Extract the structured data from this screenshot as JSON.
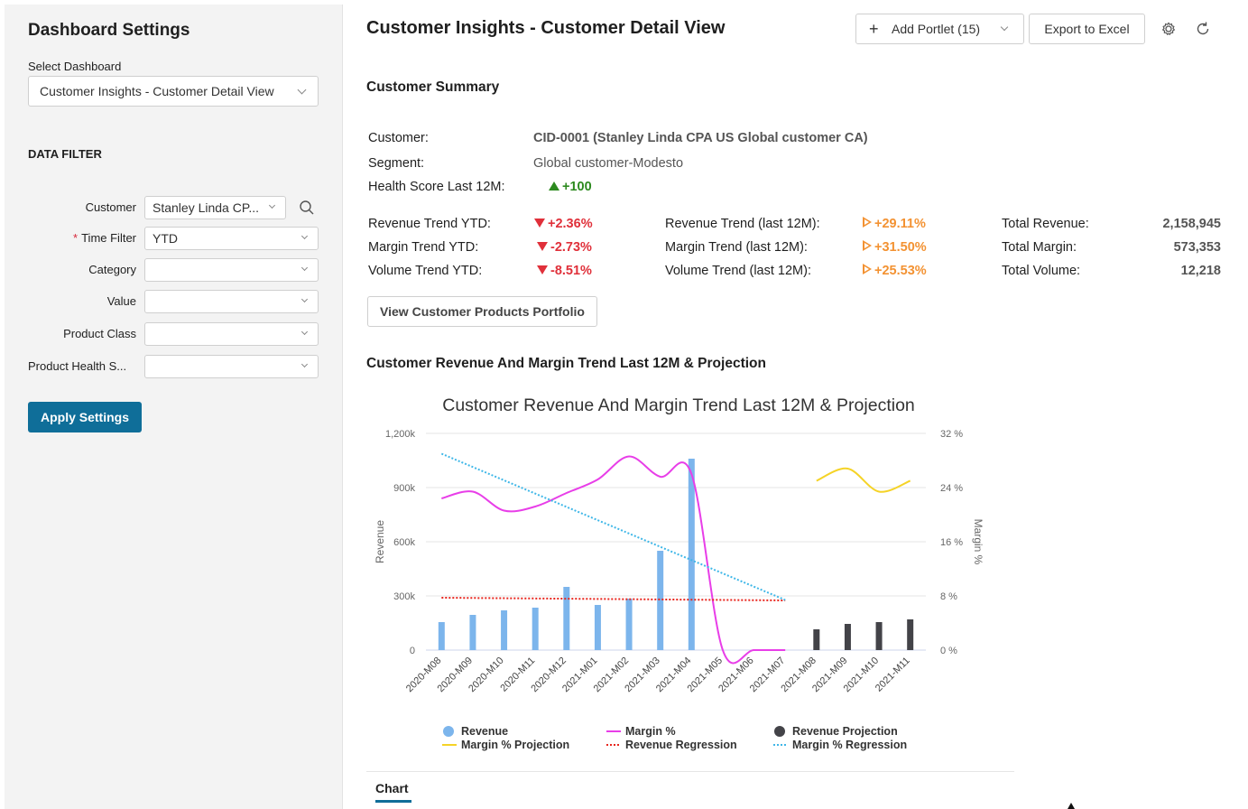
{
  "sidebar": {
    "title": "Dashboard Settings",
    "select_label": "Select Dashboard",
    "selected_dashboard": "Customer Insights - Customer Detail View",
    "filter_title": "DATA FILTER",
    "filters": [
      {
        "label": "Customer",
        "value": "Stanley Linda CP...",
        "required": false
      },
      {
        "label": "Time Filter",
        "value": "YTD",
        "required": true
      },
      {
        "label": "Category",
        "value": "",
        "required": false
      },
      {
        "label": "Value",
        "value": "",
        "required": false
      },
      {
        "label": "Product Class",
        "value": "",
        "required": false
      },
      {
        "label": "Product Health S...",
        "value": "",
        "required": false
      }
    ],
    "apply_label": "Apply Settings"
  },
  "header": {
    "title": "Customer Insights - Customer Detail View",
    "add_portlet_label": "Add Portlet (15)",
    "export_label": "Export to Excel",
    "icons": [
      "gear-icon",
      "refresh-icon"
    ]
  },
  "summary": {
    "title": "Customer Summary",
    "customer_label": "Customer:",
    "customer_value": "CID-0001 (Stanley Linda CPA US Global customer CA)",
    "segment_label": "Segment:",
    "segment_value": "Global customer-Modesto",
    "health_label": "Health Score Last 12M:",
    "health_value": "+100",
    "trends_ytd": [
      {
        "label": "Revenue Trend YTD:",
        "value": "+2.36%"
      },
      {
        "label": "Margin Trend YTD:",
        "value": "-2.73%"
      },
      {
        "label": "Volume Trend YTD:",
        "value": "-8.51%"
      }
    ],
    "trends_12m": [
      {
        "label": "Revenue Trend (last 12M):",
        "value": "+29.11%"
      },
      {
        "label": "Margin Trend (last 12M):",
        "value": "+31.50%"
      },
      {
        "label": "Volume Trend (last 12M):",
        "value": "+25.53%"
      }
    ],
    "totals": [
      {
        "label": "Total Revenue:",
        "value": "2,158,945"
      },
      {
        "label": "Total Margin:",
        "value": "573,353"
      },
      {
        "label": "Total Volume:",
        "value": "12,218"
      }
    ],
    "portfolio_button": "View Customer Products Portfolio"
  },
  "chart_section": {
    "title": "Customer Revenue And Margin Trend Last 12M & Projection",
    "tab_label": "Chart"
  },
  "chart_data": {
    "type": "bar",
    "title": "Customer Revenue And Margin Trend Last 12M & Projection",
    "ylabel": "Revenue",
    "y2label": "Margin %",
    "ylim": [
      0,
      1200000
    ],
    "y2lim": [
      0,
      32
    ],
    "yticks": [
      "0",
      "300k",
      "600k",
      "900k",
      "1,200k"
    ],
    "y2ticks": [
      "0 %",
      "8 %",
      "16 %",
      "24 %",
      "32 %"
    ],
    "categories": [
      "2020-M08",
      "2020-M09",
      "2020-M10",
      "2020-M11",
      "2020-M12",
      "2021-M01",
      "2021-M02",
      "2021-M03",
      "2021-M04",
      "2021-M05",
      "2021-M06",
      "2021-M07",
      "2021-M08",
      "2021-M09",
      "2021-M10",
      "2021-M11"
    ],
    "series": [
      {
        "name": "Revenue",
        "kind": "bar",
        "color": "#7cb5ec",
        "values": [
          155000,
          195000,
          220000,
          235000,
          350000,
          250000,
          285000,
          550000,
          1060000,
          0,
          0,
          0,
          null,
          null,
          null,
          null
        ]
      },
      {
        "name": "Margin %",
        "kind": "line",
        "axis": "right",
        "color": "#e83ee8",
        "values": [
          22.4,
          23.4,
          20.6,
          21.2,
          23.2,
          25.2,
          28.6,
          25.6,
          26.0,
          0,
          0,
          0,
          null,
          null,
          null,
          null
        ]
      },
      {
        "name": "Revenue Projection",
        "kind": "bar",
        "color": "#434348",
        "values": [
          null,
          null,
          null,
          null,
          null,
          null,
          null,
          null,
          null,
          null,
          null,
          null,
          115000,
          145000,
          155000,
          170000
        ]
      },
      {
        "name": "Margin % Projection",
        "kind": "line",
        "axis": "right",
        "color": "#f5d327",
        "values": [
          null,
          null,
          null,
          null,
          null,
          null,
          null,
          null,
          null,
          null,
          null,
          null,
          25.0,
          26.8,
          23.4,
          25.0
        ]
      },
      {
        "name": "Revenue Regression",
        "kind": "dotted",
        "color": "#e8261e",
        "values": [
          290000,
          null,
          null,
          null,
          null,
          null,
          null,
          null,
          null,
          null,
          null,
          275000,
          null,
          null,
          null,
          null
        ]
      },
      {
        "name": "Margin % Regression",
        "kind": "dotted",
        "axis": "right",
        "color": "#3fb7e8",
        "values": [
          29.0,
          null,
          null,
          null,
          null,
          null,
          null,
          null,
          null,
          null,
          null,
          7.4,
          null,
          null,
          null,
          null
        ]
      }
    ]
  }
}
